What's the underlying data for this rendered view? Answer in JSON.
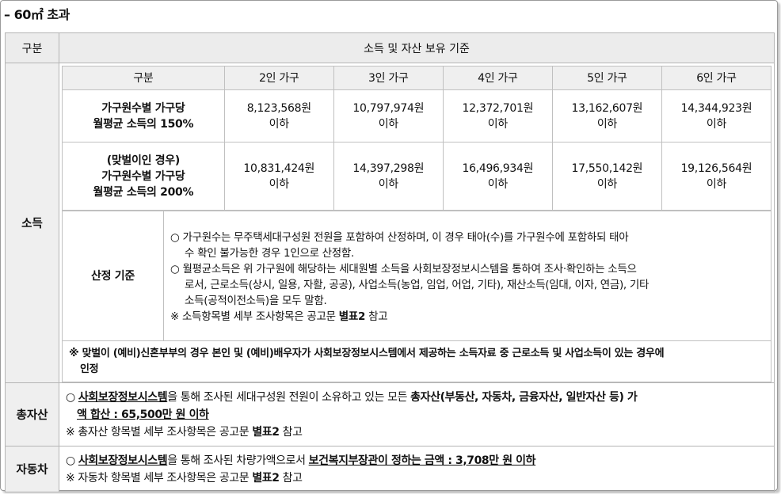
{
  "title": "– 60㎡ 초과",
  "header": {
    "col1": "구분",
    "col2": "소득 및 자산 보유 기준"
  },
  "income": {
    "label": "소득",
    "table_header": [
      "구분",
      "2인 가구",
      "3인 가구",
      "4인 가구",
      "5인 가구",
      "6인 가구"
    ],
    "rows": [
      {
        "label_lines": [
          "가구원수별 가구당",
          "월평균 소득의 150%"
        ],
        "values": [
          "8,123,568원",
          "10,797,974원",
          "12,372,701원",
          "13,162,607원",
          "14,344,923원"
        ],
        "suffix": "이하"
      },
      {
        "label_lines": [
          "(맞벌이인 경우)",
          "가구원수별 가구당",
          "월평균 소득의 200%"
        ],
        "values": [
          "10,831,424원",
          "14,397,298원",
          "16,496,934원",
          "17,550,142원",
          "19,126,564원"
        ],
        "suffix": "이하"
      }
    ],
    "calc_label": "산정 기준",
    "calc_lines": [
      "○ 가구원수는 무주택세대구성원 전원을 포함하여 산정하며, 이 경우 태아(수)를 가구원수에 포함하되 태아",
      "   수 확인 불가능한 경우 1인으로 산정함.",
      "○ 월평균소득은 위 가구원에 해당하는 세대원별 소득을 사회보장정보시스템을 통하여 조사·확인하는 소득으",
      "   로서, 근로소득(상시, 일용, 자활, 공공), 사업소득(농업, 임업, 어업, 기타), 재산소득(임대, 이자, 연금), 기타",
      "   소득(공적이전소득)을 모두 말함."
    ],
    "calc_ref_prefix": "※ 소득항목별 세부 조사항목은 공고문 ",
    "calc_ref_bold": "별표2",
    "calc_ref_suffix": " 참고",
    "note_lines": [
      "※ 맞벌이 (예비)신혼부부의 경우 본인 및 (예비)배우자가 사회보장정보시스템에서 제공하는 소득자료 중 근로소득 및 사업소득이 있는 경우에",
      "인정"
    ]
  },
  "assets": {
    "label": "총자산",
    "line1_a": "○ ",
    "line1_b": "사회보장정보시스템",
    "line1_c": "을 통해 조사된 세대구성원 전원이 소유하고 있는 모든 ",
    "line1_d": "총자산(부동산, 자동차, 금융자산, 일반자산 등) 가",
    "line2": "액 합산 : 65,500만 원 이하",
    "ref_prefix": "※ 총자산 항목별 세부 조사항목은 공고문 ",
    "ref_bold": "별표2",
    "ref_suffix": " 참고"
  },
  "car": {
    "label": "자동차",
    "line1_a": "○ ",
    "line1_b": "사회보장정보시스템",
    "line1_c": "을 통해 조사된 차량가액으로서 ",
    "line1_d": "보건복지부장관이 정하는 금액 : 3,708만 원 이하",
    "ref_prefix": "※ 자동차 항목별 세부 조사항목은 공고문 ",
    "ref_bold": "별표2",
    "ref_suffix": " 참고"
  }
}
